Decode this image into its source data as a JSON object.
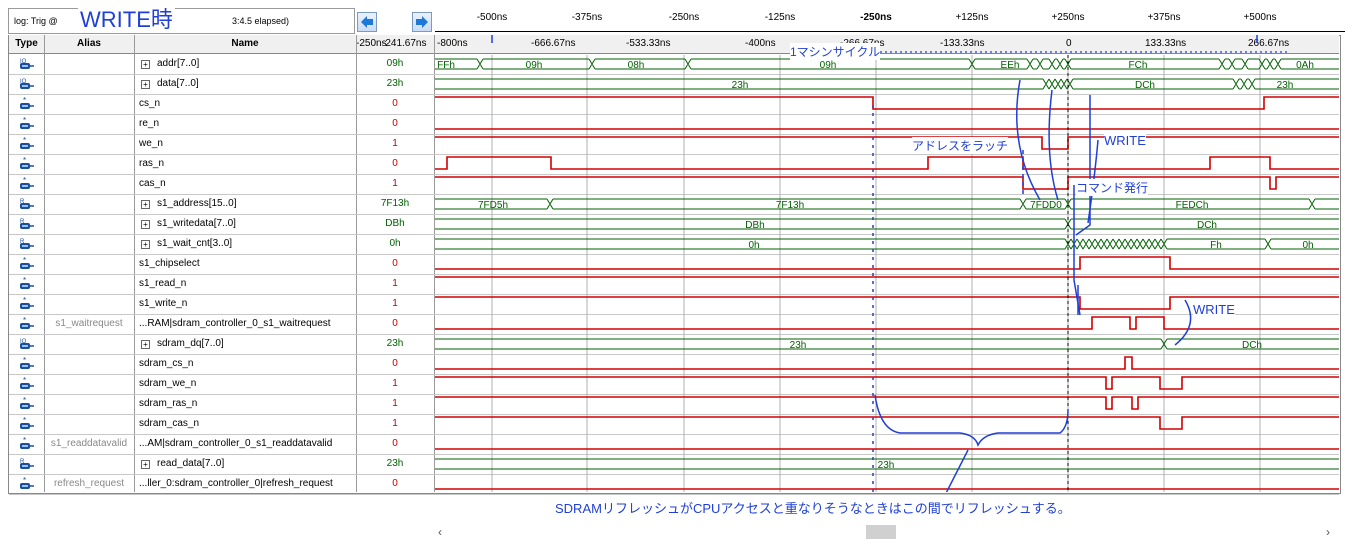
{
  "header": {
    "log_prefix": "log: Trig @",
    "log_suffix": "3:4.5 elapsed)",
    "overlay_title": "WRITE時",
    "nav_left_icon": "arrow-left-icon",
    "nav_right_icon": "arrow-right-icon",
    "top_ticks": [
      "-500ns",
      "-375ns",
      "-250ns",
      "-125ns",
      "-250ns",
      "+125ns",
      "+250ns",
      "+375ns",
      "+500ns"
    ],
    "time_ticks": [
      "-800ns",
      "-666.67ns",
      "-533.33ns",
      "-400ns",
      "-266.67ns",
      "-133.33ns",
      "0",
      "133.33ns",
      "266.67ns"
    ],
    "value_col_label": "-250ns",
    "value_col_label2": "-241.67ns"
  },
  "columns": {
    "type": "Type",
    "alias": "Alias",
    "name": "Name"
  },
  "signals": [
    {
      "type_icon": "bus-output-icon",
      "alias": "",
      "name": "addr[7..0]",
      "expandable": true,
      "value": "09h"
    },
    {
      "type_icon": "bus-io-icon",
      "alias": "",
      "name": "data[7..0]",
      "expandable": true,
      "value": "23h"
    },
    {
      "type_icon": "signal-icon",
      "alias": "",
      "name": "cs_n",
      "expandable": false,
      "value": "0"
    },
    {
      "type_icon": "signal-icon",
      "alias": "",
      "name": "re_n",
      "expandable": false,
      "value": "0"
    },
    {
      "type_icon": "signal-icon",
      "alias": "",
      "name": "we_n",
      "expandable": false,
      "value": "1"
    },
    {
      "type_icon": "signal-icon",
      "alias": "",
      "name": "ras_n",
      "expandable": false,
      "value": "0"
    },
    {
      "type_icon": "signal-icon",
      "alias": "",
      "name": "cas_n",
      "expandable": false,
      "value": "1"
    },
    {
      "type_icon": "bus-reg-icon",
      "alias": "",
      "name": "s1_address[15..0]",
      "expandable": true,
      "value": "7F13h"
    },
    {
      "type_icon": "bus-reg-icon",
      "alias": "",
      "name": "s1_writedata[7..0]",
      "expandable": true,
      "value": "DBh"
    },
    {
      "type_icon": "bus-reg-icon",
      "alias": "",
      "name": "s1_wait_cnt[3..0]",
      "expandable": true,
      "value": "0h"
    },
    {
      "type_icon": "signal-icon",
      "alias": "",
      "name": "s1_chipselect",
      "expandable": false,
      "value": "0"
    },
    {
      "type_icon": "signal-icon",
      "alias": "",
      "name": "s1_read_n",
      "expandable": false,
      "value": "1"
    },
    {
      "type_icon": "signal-icon",
      "alias": "",
      "name": "s1_write_n",
      "expandable": false,
      "value": "1"
    },
    {
      "type_icon": "signal-icon",
      "alias": "s1_waitrequest",
      "name": "...RAM|sdram_controller_0_s1_waitrequest",
      "expandable": false,
      "value": "0"
    },
    {
      "type_icon": "bus-io-icon",
      "alias": "",
      "name": "sdram_dq[7..0]",
      "expandable": true,
      "value": "23h"
    },
    {
      "type_icon": "signal-icon",
      "alias": "",
      "name": "sdram_cs_n",
      "expandable": false,
      "value": "0"
    },
    {
      "type_icon": "signal-icon",
      "alias": "",
      "name": "sdram_we_n",
      "expandable": false,
      "value": "1"
    },
    {
      "type_icon": "signal-icon",
      "alias": "",
      "name": "sdram_ras_n",
      "expandable": false,
      "value": "1"
    },
    {
      "type_icon": "signal-icon",
      "alias": "",
      "name": "sdram_cas_n",
      "expandable": false,
      "value": "1"
    },
    {
      "type_icon": "signal-icon",
      "alias": "s1_readdatavalid",
      "name": "...AM|sdram_controller_0_s1_readdatavalid",
      "expandable": false,
      "value": "0"
    },
    {
      "type_icon": "bus-reg-icon",
      "alias": "",
      "name": "read_data[7..0]",
      "expandable": true,
      "value": "23h"
    },
    {
      "type_icon": "signal-icon",
      "alias": "refresh_request",
      "name": "...ller_0:sdram_controller_0|refresh_request",
      "expandable": false,
      "value": "0"
    }
  ],
  "bus_labels": {
    "addr": [
      "FFh",
      "09h",
      "08h",
      "09h",
      "EEh",
      "FCh",
      "0Ah"
    ],
    "data": [
      "23h",
      "DCh",
      "23h"
    ],
    "s1_address": [
      "7FD5h",
      "7F13h",
      "7FDD0",
      "FEDCh"
    ],
    "s1_writedata": [
      "DBh",
      "DCh"
    ],
    "s1_wait_cnt": [
      "0h",
      "Fh",
      "0h"
    ],
    "sdram_dq": [
      "23h",
      "DCh"
    ],
    "read_data": [
      "23h"
    ]
  },
  "annotations": {
    "machine_cycle": "1マシンサイクル",
    "latch": "アドレスをラッチ",
    "write1": "WRITE",
    "command": "コマンド発行",
    "write2": "WRITE",
    "refresh": "SDRAMリフレッシュがCPUアクセスと重なりそうなときはこの間でリフレッシュする。"
  },
  "scrollbar": {
    "left_icon": "chevron-left-icon",
    "right_icon": "chevron-right-icon"
  },
  "colors": {
    "bus": "#006000",
    "signal": "#d00000",
    "annotation": "#1f3fd8",
    "grid": "#b0b0b0"
  }
}
